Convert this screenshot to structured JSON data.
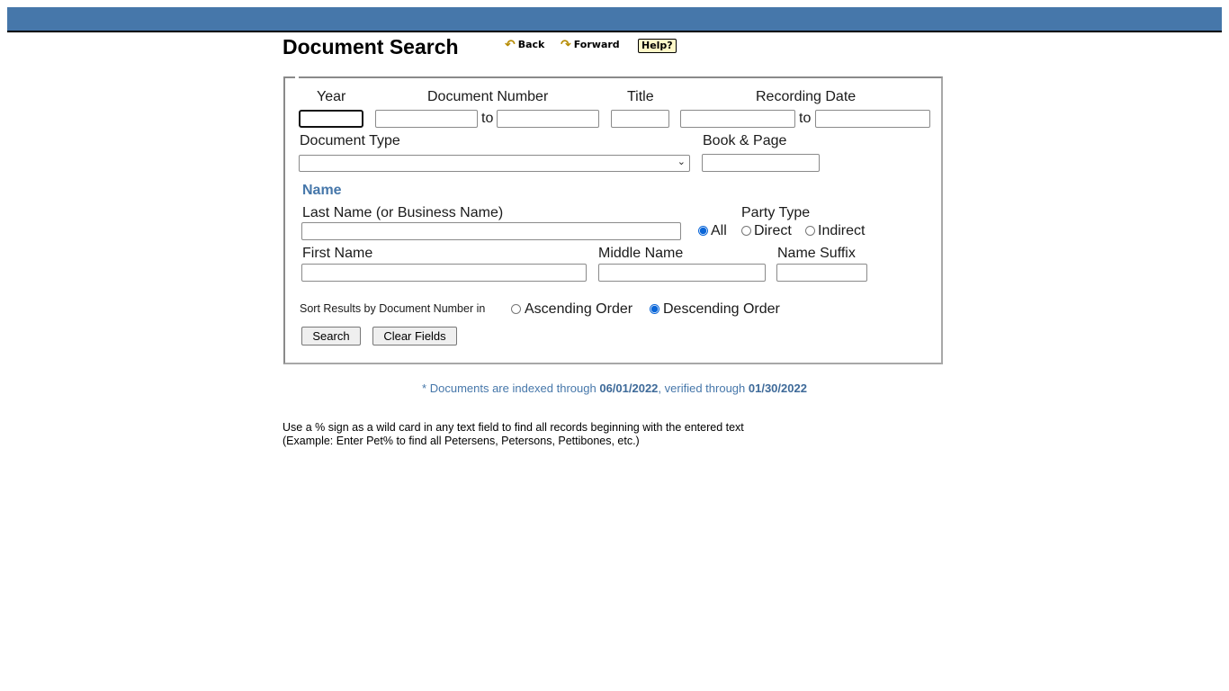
{
  "header": {
    "title": "Document Search",
    "nav": {
      "back": "Back",
      "forward": "Forward",
      "help": "Help?"
    }
  },
  "form": {
    "year": {
      "label": "Year",
      "value": ""
    },
    "document_number": {
      "label": "Document Number",
      "from": "",
      "to": "",
      "to_label": "to"
    },
    "title": {
      "label": "Title",
      "value": ""
    },
    "recording_date": {
      "label": "Recording Date",
      "from": "",
      "to": "",
      "to_label": "to"
    },
    "document_type": {
      "label": "Document Type",
      "selected": ""
    },
    "book_page": {
      "label": "Book & Page",
      "value": ""
    },
    "name_section": "Name",
    "last_name": {
      "label": "Last Name (or Business Name)",
      "value": ""
    },
    "party_type": {
      "label": "Party Type",
      "options": [
        "All",
        "Direct",
        "Indirect"
      ],
      "selected": "All"
    },
    "first_name": {
      "label": "First Name",
      "value": ""
    },
    "middle_name": {
      "label": "Middle Name",
      "value": ""
    },
    "name_suffix": {
      "label": "Name Suffix",
      "value": ""
    },
    "sort": {
      "label": "Sort Results by Document Number in",
      "options": [
        "Ascending Order",
        "Descending Order"
      ],
      "selected": "Descending Order"
    },
    "buttons": {
      "search": "Search",
      "clear": "Clear Fields"
    }
  },
  "status": {
    "prefix": "* Documents are indexed through ",
    "indexed_date": "06/01/2022",
    "middle": ", verified through ",
    "verified_date": "01/30/2022"
  },
  "tips": {
    "line1": "Use a % sign as a wild card in any text field to find all records beginning with the entered text",
    "line2": "(Example: Enter Pet% to find all Petersens, Petersons, Pettibones, etc.)"
  }
}
